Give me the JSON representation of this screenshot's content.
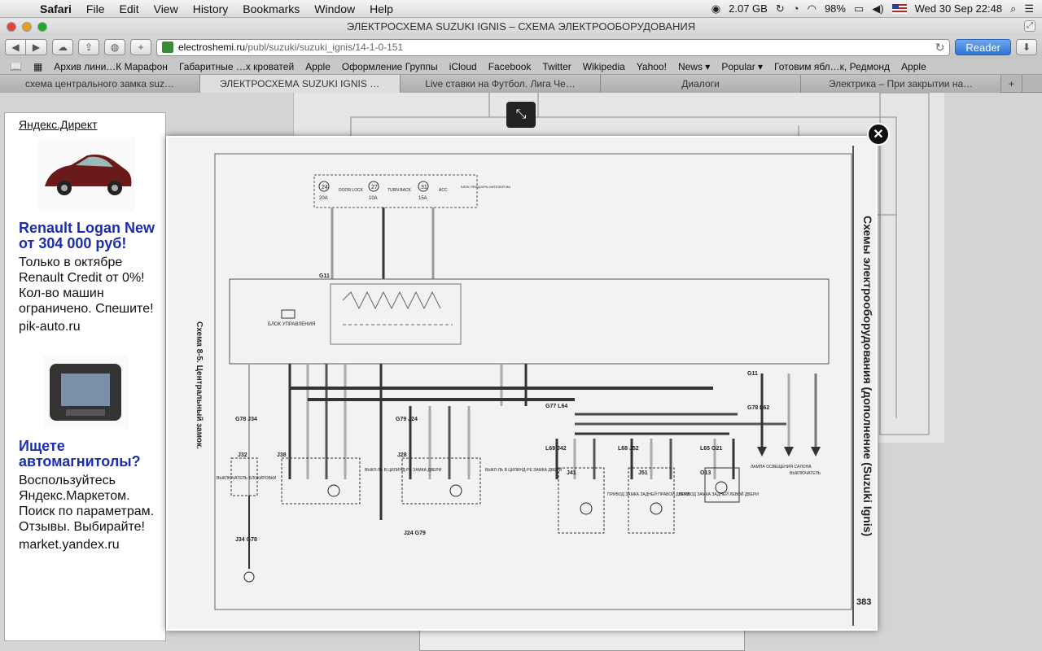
{
  "menubar": {
    "app_name": "Safari",
    "items": [
      "File",
      "Edit",
      "View",
      "History",
      "Bookmarks",
      "Window",
      "Help"
    ],
    "memory": "2.07 GB",
    "battery": "98%",
    "datetime": "Wed 30 Sep  22:48"
  },
  "window": {
    "title": "ЭЛЕКТРОСХЕМА SUZUKI IGNIS – СХЕМА ЭЛЕКТРООБОРУДОВАНИЯ"
  },
  "toolbar": {
    "url_domain": "electroshemi.ru",
    "url_path": "/publ/suzuki/suzuki_ignis/14-1-0-151",
    "reader_label": "Reader"
  },
  "bookmarks": [
    "Архив лини…К Марафон",
    "Габаритные …х кроватей",
    "Apple",
    "Оформление Группы",
    "iCloud",
    "Facebook",
    "Twitter",
    "Wikipedia",
    "Yahoo!",
    "News ▾",
    "Popular ▾",
    "Готовим ябл…к, Редмонд",
    "Apple"
  ],
  "tabs": [
    "схема центрального замка suz…",
    "ЭЛЕКТРОСХЕМА SUZUKI IGNIS –…",
    "Live ставки на Футбол. Лига Че…",
    "Диалоги",
    "Электрика – При закрытии на…"
  ],
  "ad": {
    "header": "Яндекс.Директ",
    "block1": {
      "title": "Renault Logan New от 304 000 руб!",
      "text": "Только в октябре Renault Credit от 0%! Кол-во машин ограничено. Спешите!",
      "site": "pik-auto.ru"
    },
    "block2": {
      "title": "Ищете автомагнитолы?",
      "text": "Воспользуйтесь Яндекс.Маркетом. Поиск по параметрам. Отзывы. Выбирайте!",
      "site": "market.yandex.ru"
    }
  },
  "diagram": {
    "caption_left": "Схема 8-5. Центральный замок.",
    "caption_right": "Схемы электрооборудования (дополнение (Suzuki Ignis)",
    "page_number": "383",
    "fuses": [
      {
        "num": "24",
        "amp": "20A",
        "label": "DOOR LOCK"
      },
      {
        "num": "27",
        "amp": "10A",
        "label": "TURN BACK"
      },
      {
        "num": "31",
        "amp": "15A",
        "label": "ACC"
      }
    ],
    "fuse_block": "БЛОК ПРЕДОХРА-НИТЕЛЕЙ №1",
    "control_unit": "БЛОК УПРАВЛЕНИЯ",
    "connectors": [
      "G11",
      "G78 J34",
      "J32",
      "J38",
      "G79 J24",
      "J28",
      "G77 L64",
      "L69 J42",
      "J41",
      "L68 J52",
      "J51",
      "L65 O21",
      "O13",
      "J34 G78",
      "J24 G79",
      "G11",
      "G78 L62"
    ],
    "labels_bottom": [
      "ВЫКЛЮЧАТЕЛЬ БЛОКИРОВКИ",
      "ВЫКЛ-ЛЬ В ЦИЛИНД-РЕ ЗАМКА ДВЕРИ",
      "ВЫКЛ-ЛЬ В ЦИЛИНД-РЕ ЗАМКА ДВЕРИ",
      "ПРИВОД ЗАМКА ЗАДНЕЙ ПРАВОЙ ДВЕРИ",
      "ПРИВОД ЗАМКА ЗАДНЕЙ ЛЕВОЙ ДВЕРИ",
      "ЛАМПА ОСВЕЩЕНИЯ САЛОНА",
      "ВЫКЛЮЧАТЕЛЬ"
    ]
  }
}
